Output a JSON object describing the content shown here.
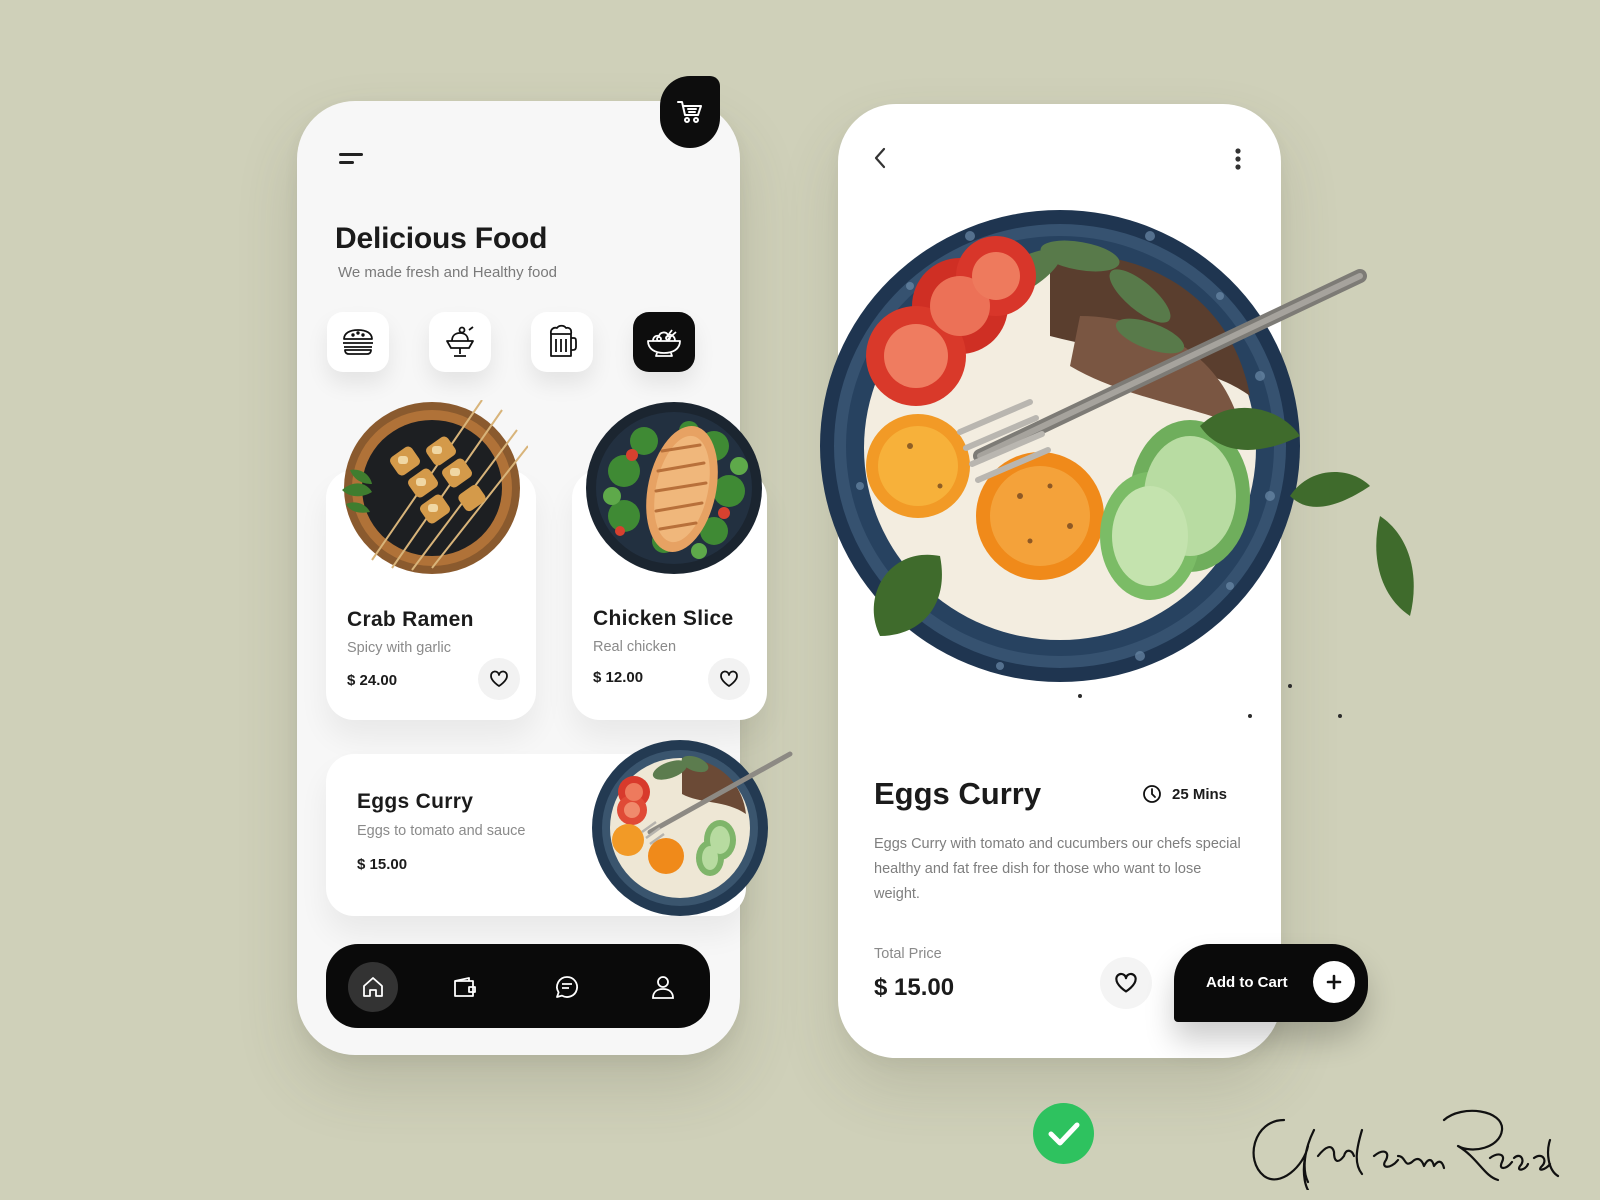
{
  "colors": {
    "background": "#cfd0b9",
    "dark": "#0a0a0a",
    "card": "#ffffff",
    "muted_text": "#7e7e7e",
    "check_green": "#2ec25f"
  },
  "home": {
    "header": {
      "menu_icon": "menu-icon",
      "cart_icon": "cart-icon"
    },
    "title": "Delicious Food",
    "subtitle": "We made fresh and Healthy food",
    "categories": [
      {
        "icon": "burger-icon",
        "active": false
      },
      {
        "icon": "ice-cream-icon",
        "active": false
      },
      {
        "icon": "beer-mug-icon",
        "active": false
      },
      {
        "icon": "salad-bowl-icon",
        "active": true
      }
    ],
    "cards": [
      {
        "name": "Crab Ramen",
        "desc": "Spicy with garlic",
        "price": "$ 24.00"
      },
      {
        "name": "Chicken Slice",
        "desc": "Real chicken",
        "price": "$ 12.00"
      }
    ],
    "wide_card": {
      "name": "Eggs Curry",
      "desc": "Eggs to tomato and sauce",
      "price": "$ 15.00"
    },
    "nav": [
      {
        "icon": "home-icon",
        "active": true
      },
      {
        "icon": "wallet-icon",
        "active": false
      },
      {
        "icon": "chat-icon",
        "active": false
      },
      {
        "icon": "user-icon",
        "active": false
      }
    ]
  },
  "detail": {
    "title": "Eggs Curry",
    "time": "25 Mins",
    "description": "Eggs Curry with tomato and cucumbers our chefs special healthy and fat free dish for those who want to lose weight.",
    "total_label": "Total Price",
    "total_price": "$ 15.00",
    "add_to_cart_label": "Add to Cart"
  },
  "signature": "Ghulam Rasool"
}
